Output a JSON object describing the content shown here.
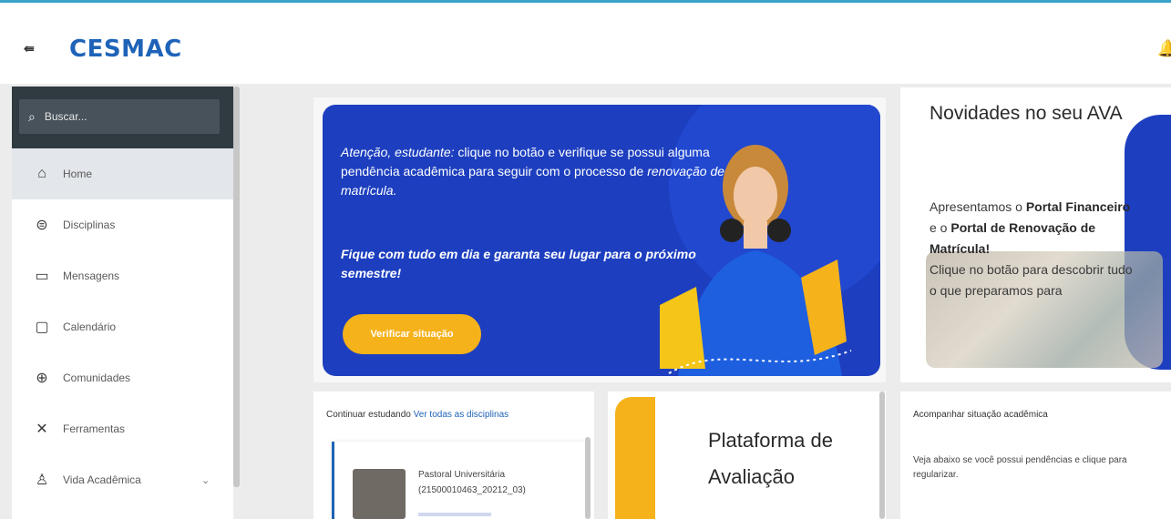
{
  "header": {
    "menu_icon": "collapse-menu-icon",
    "logo": "CESMAC",
    "bell_icon": "bell-icon"
  },
  "sidebar": {
    "search_placeholder": "Buscar...",
    "items": [
      {
        "label": "Home",
        "icon": "home-icon",
        "active": true
      },
      {
        "label": "Disciplinas",
        "icon": "disciplines-icon"
      },
      {
        "label": "Mensagens",
        "icon": "message-icon"
      },
      {
        "label": "Calendário",
        "icon": "calendar-icon"
      },
      {
        "label": "Comunidades",
        "icon": "globe-icon"
      },
      {
        "label": "Ferramentas",
        "icon": "tools-icon"
      },
      {
        "label": "Vida Acadêmica",
        "icon": "person-icon",
        "expandable": true
      }
    ]
  },
  "banner": {
    "line1_italic": "Atenção, estudante:",
    "line1_rest": " clique no botão e verifique se possui alguma pendência acadêmica para seguir com o processo de ",
    "line1_italic_end": "renovação de matrícula.",
    "line2": "Fique com tudo em dia e garanta seu lugar para o próximo semestre!",
    "button": "Verificar situação"
  },
  "news": {
    "title": "Novidades no seu AVA",
    "intro": "Apresentamos o ",
    "portal1": "Portal Financeiro",
    "join": "e o ",
    "portal2": "Portal de Renovação de Matrícula!",
    "cta": "Clique no botão para descobrir tudo o que preparamos para"
  },
  "study": {
    "heading": "Continuar estudando",
    "link": "Ver todas as disciplinas",
    "course_name": "Pastoral Universitária (21500010463_20212_03)"
  },
  "eval": {
    "title": "Plataforma de Avaliação"
  },
  "status": {
    "heading": "Acompanhar situação acadêmica",
    "body": "Veja abaixo se você possui pendências e clique para regularizar."
  }
}
